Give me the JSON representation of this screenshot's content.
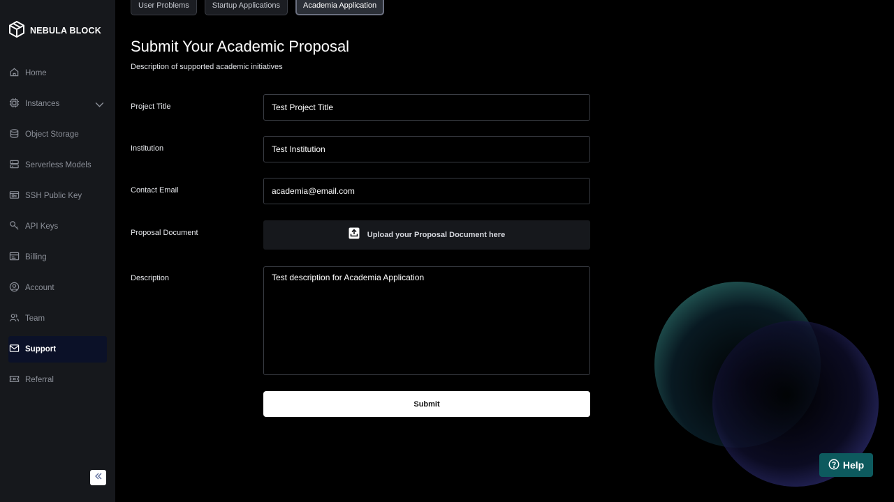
{
  "brand": {
    "name": "NEBULA BLOCK",
    "logo_icon": "cube-logo-icon"
  },
  "sidebar": {
    "items": [
      {
        "label": "Home",
        "icon": "home-icon"
      },
      {
        "label": "Instances",
        "icon": "chip-icon"
      },
      {
        "label": "Object Storage",
        "icon": "database-icon"
      },
      {
        "label": "Serverless Models",
        "icon": "server-icon"
      },
      {
        "label": "SSH Public Key",
        "icon": "key-card-icon"
      },
      {
        "label": "API Keys",
        "icon": "key-icon"
      },
      {
        "label": "Billing",
        "icon": "billing-icon"
      },
      {
        "label": "Account",
        "icon": "account-icon"
      },
      {
        "label": "Team",
        "icon": "team-icon"
      },
      {
        "label": "Support",
        "icon": "mail-icon",
        "active": true
      },
      {
        "label": "Referral",
        "icon": "ticket-icon"
      }
    ],
    "collapse_icon": "double-chevron-left-icon"
  },
  "tabs": [
    {
      "label": "User Problems"
    },
    {
      "label": "Startup Applications"
    },
    {
      "label": "Academia Application",
      "active": true
    }
  ],
  "page": {
    "title": "Submit Your Academic Proposal",
    "subtitle": "Description of supported academic initiatives"
  },
  "form": {
    "project_title": {
      "label": "Project Title",
      "value": "Test Project Title"
    },
    "institution": {
      "label": "Institution",
      "value": "Test Institution"
    },
    "contact_email": {
      "label": "Contact Email",
      "value": "academia@email.com"
    },
    "proposal_document": {
      "label": "Proposal Document",
      "upload_text": "Upload your Proposal Document here",
      "icon": "upload-icon"
    },
    "description": {
      "label": "Description",
      "value": "Test description for Academia Application"
    },
    "submit_label": "Submit"
  },
  "help": {
    "label": "Help",
    "icon": "question-circle-icon"
  },
  "colors": {
    "background": "#000000",
    "sidebar": "#16181c",
    "active_nav": "#0b1128",
    "help_button": "#0d5a5e",
    "submit_button": "#ffffff"
  }
}
